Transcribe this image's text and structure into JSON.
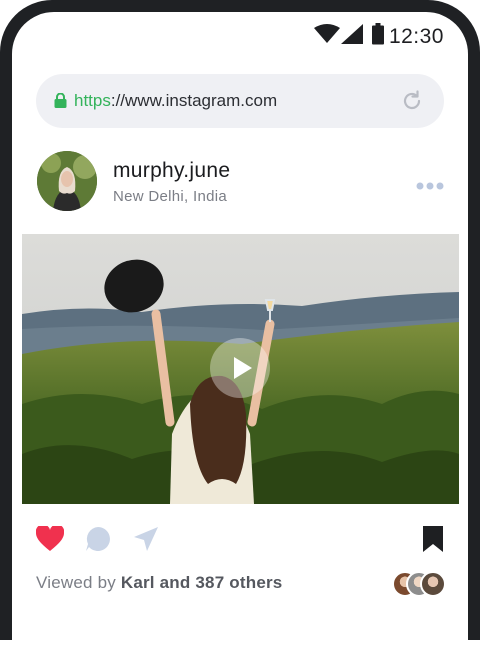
{
  "status_bar": {
    "time": "12:30",
    "icons": [
      "wifi-icon",
      "signal-icon",
      "battery-icon"
    ]
  },
  "browser": {
    "url_scheme": "https",
    "url_rest": "://www.instagram.com",
    "lock_icon": "lock-icon",
    "reload_icon": "reload-icon"
  },
  "post": {
    "username": "murphy.june",
    "location": "New Delhi, India",
    "media_type": "video",
    "viewed_prefix": "Viewed by ",
    "viewed_names": "Karl and 387 others"
  },
  "colors": {
    "accent_green": "#33b35a",
    "like_red": "#f0314e",
    "icon_blue_gray": "#c9d4e6",
    "frame": "#1f2124"
  }
}
